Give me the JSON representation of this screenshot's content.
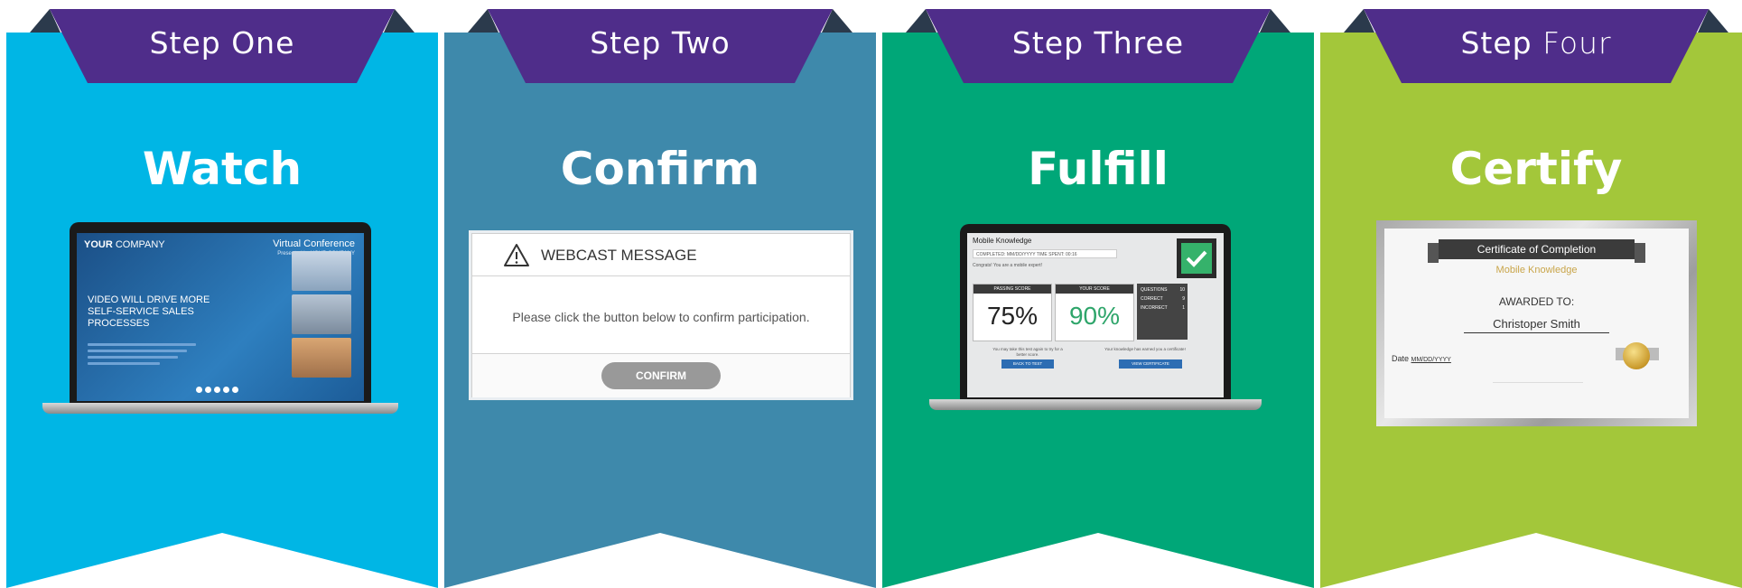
{
  "colors": {
    "tab": "#4f2d8a",
    "tab_dark": "#2b3a4c",
    "panel1": "#00b6e5",
    "panel2": "#3e89ab",
    "panel3": "#00a778",
    "panel4": "#a3c73a"
  },
  "panels": [
    {
      "step": "Step One",
      "title": "Watch"
    },
    {
      "step": "Step Two",
      "title": "Confirm"
    },
    {
      "step": "Step Three",
      "title": "Fulfill"
    },
    {
      "step_a": "Step",
      "step_b": "Four",
      "title": "Certify"
    }
  ],
  "webcast": {
    "company_a": "YOUR",
    "company_b": " COMPANY",
    "event": "Virtual Conference",
    "presented": "Presented by YOUR COMPANY",
    "headline": "VIDEO WILL DRIVE MORE SELF-SERVICE SALES PROCESSES"
  },
  "dialog": {
    "title": "WEBCAST MESSAGE",
    "message": "Please click the button below to confirm participation.",
    "button": "CONFIRM"
  },
  "results": {
    "title": "Mobile Knowledge",
    "completed": "COMPLETED: MM/DD/YYYY      TIME SPENT: 00:16",
    "congrats": "Congrats! You are a mobile expert!",
    "passing_label": "PASSING SCORE",
    "passing_value": "75%",
    "your_label": "YOUR SCORE",
    "your_value": "90%",
    "questions_label": "QUESTIONS",
    "questions_value": "10",
    "correct_label": "CORRECT",
    "correct_value": "9",
    "incorrect_label": "INCORRECT",
    "incorrect_value": "1",
    "note_left": "You may take this test again to try for a better score.",
    "note_right": "Your knowledge has earned you a certificate!",
    "back_button": "BACK TO TEST",
    "cert_button": "VIEW CERTIFICATE"
  },
  "certificate": {
    "heading": "Certificate of Completion",
    "course": "Mobile Knowledge",
    "awarded": "AWARDED TO:",
    "name": "Christoper Smith",
    "date_label": "Date ",
    "date_value": "MM/DD/YYYY"
  }
}
